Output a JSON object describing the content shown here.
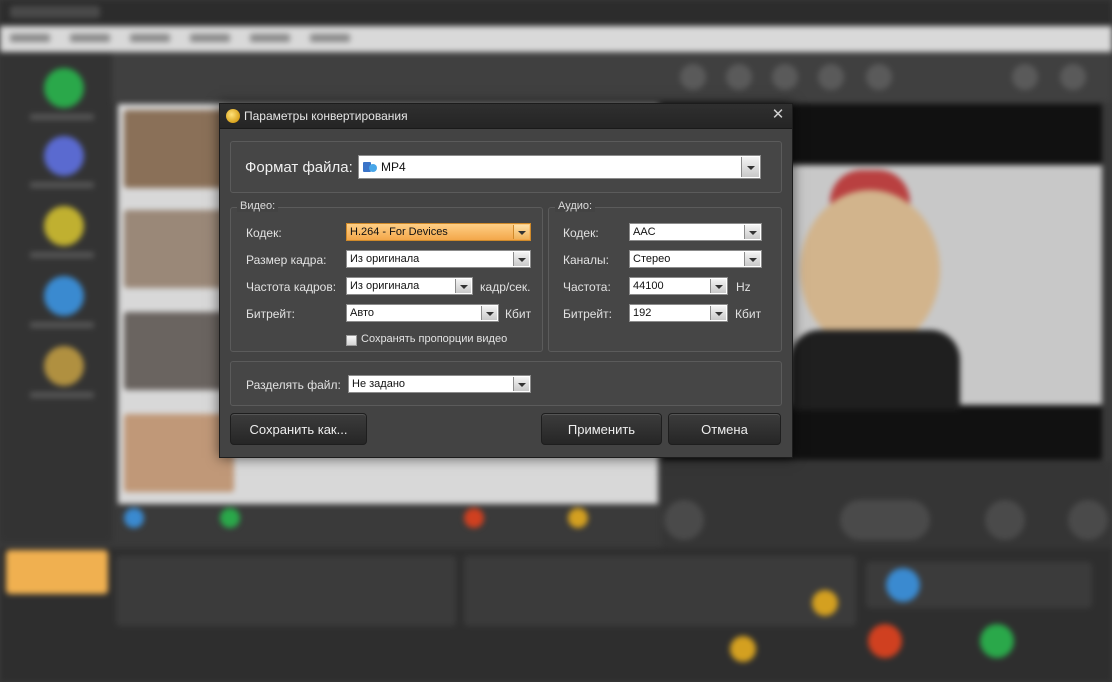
{
  "dialog": {
    "title": "Параметры конвертирования",
    "title_icon": "film-reel-icon",
    "close_symbol": "✕",
    "format": {
      "label": "Формат файла:",
      "value": "MP4",
      "icon": "mp4-format-icon"
    },
    "video": {
      "legend": "Видео:",
      "codec_label": "Кодек:",
      "codec_value": "H.264 - For Devices",
      "frame_size_label": "Размер кадра:",
      "frame_size_value": "Из оригинала",
      "frame_rate_label": "Частота кадров:",
      "frame_rate_value": "Из оригинала",
      "frame_rate_unit": "кадр/сек.",
      "bitrate_label": "Битрейт:",
      "bitrate_value": "Авто",
      "bitrate_unit": "Кбит",
      "keep_aspect_label": "Сохранять пропорции видео",
      "keep_aspect_checked": false
    },
    "audio": {
      "legend": "Аудио:",
      "codec_label": "Кодек:",
      "codec_value": "AAC",
      "channels_label": "Каналы:",
      "channels_value": "Стерео",
      "frequency_label": "Частота:",
      "frequency_value": "44100",
      "frequency_unit": "Hz",
      "bitrate_label": "Битрейт:",
      "bitrate_value": "192",
      "bitrate_unit": "Кбит"
    },
    "split": {
      "label": "Разделять файл:",
      "value": "Не задано"
    },
    "buttons": {
      "save_as": "Сохранить как...",
      "apply": "Применить",
      "cancel": "Отмена"
    }
  }
}
